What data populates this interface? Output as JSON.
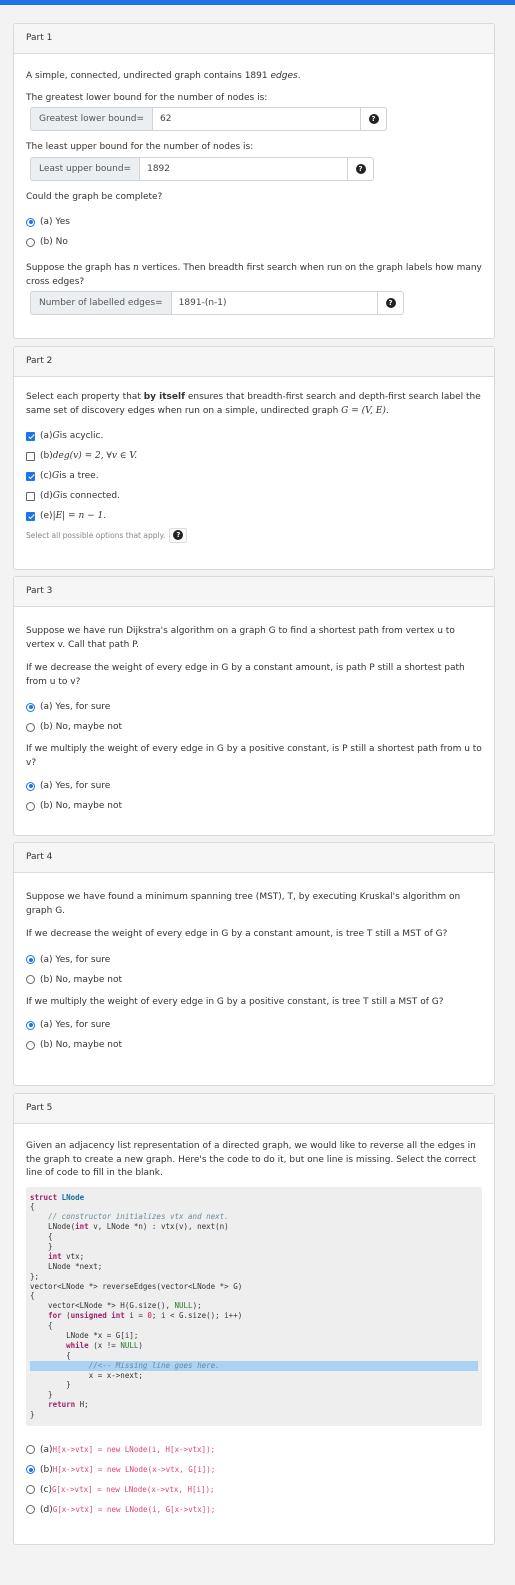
{
  "part1": {
    "title": "Part 1",
    "intro_pre": "A simple, connected, undirected graph contains 1891 ",
    "intro_em": "edges",
    "intro_post": ".",
    "q1": "The greatest lower bound for the number of nodes is:",
    "glb_label": "Greatest lower bound=",
    "glb_value": "62",
    "q2": "The least upper bound for the number of nodes is:",
    "lub_label": "Least upper bound=",
    "lub_value": "1892",
    "q3": "Could the graph be complete?",
    "opt_a": "(a) Yes",
    "opt_b": "(b) No",
    "q4_pre": "Suppose the graph has ",
    "q4_var": "n",
    "q4_post": " vertices. Then breadth first search when run on the graph labels how many cross edges?",
    "cross_label": "Number of labelled edges=",
    "cross_value": "1891-(n-1)",
    "selected": "a"
  },
  "part2": {
    "title": "Part 2",
    "prompt_pre": "Select each property that ",
    "prompt_bold": "by itself",
    "prompt_post": " ensures that breadth-first search and depth-first search label the same set of discovery edges when run on a simple, undirected graph ",
    "prompt_math": "G = (V, E).",
    "options": [
      {
        "prefix": "(e) ",
        "math": "",
        "text": ""
      },
      {
        "prefix": "",
        "math": "",
        "text": ""
      }
    ],
    "opt_a_prefix": "(a) ",
    "opt_a_math": "G",
    "opt_a_text": " is acyclic.",
    "opt_b_prefix": "(b) ",
    "opt_b_math": "deg(v) = 2, ∀v ∈ V.",
    "opt_c_prefix": "(c) ",
    "opt_c_math": "G",
    "opt_c_text": " is a tree.",
    "opt_d_prefix": "(d) ",
    "opt_d_math": "G",
    "opt_d_text": " is connected.",
    "opt_e_prefix": "(e) ",
    "opt_e_math": "|E| = n − 1.",
    "checked": {
      "a": true,
      "b": false,
      "c": true,
      "d": false,
      "e": true
    },
    "hint": "Select all possible options that apply."
  },
  "part3": {
    "title": "Part 3",
    "intro": "Suppose we have run Dijkstra's algorithm on a graph G to find a shortest path from vertex u to vertex v. Call that path P.",
    "q1": "If we decrease the weight of every edge in G by a constant amount, is path P still a shortest path from u to v?",
    "q2": "If we multiply the weight of every edge in G by a positive constant, is P still a shortest path from u to v?",
    "opt_a": "(a) Yes, for sure",
    "opt_b": "(b) No, maybe not"
  },
  "part4": {
    "title": "Part 4",
    "intro": "Suppose we have found a minimum spanning tree (MST), T, by executing Kruskal's algorithm on graph G.",
    "q1": "If we decrease the weight of every edge in G by a constant amount, is tree T still a MST of G?",
    "q2": "If we multiply the weight of every edge in G by a positive constant, is tree T still a MST of G?",
    "opt_a": "(a) Yes, for sure",
    "opt_b": "(b) No, maybe not"
  },
  "part5": {
    "title": "Part 5",
    "intro": "Given an adjacency list representation of a directed graph, we would like to reverse all the edges in the graph to create a new graph. Here's the code to do it, but one line is missing. Select the correct line of code to fill in the blank.",
    "answers": [
      {
        "prefix": "(a) ",
        "code": "H[x->vtx] = new LNode(i, H[x->vtx]);"
      },
      {
        "prefix": "(b) ",
        "code": "H[x->vtx] = new LNode(x->vtx, G[i]);"
      },
      {
        "prefix": "(c) ",
        "code": "G[x->vtx] = new LNode(x->vtx, H[i]);"
      },
      {
        "prefix": "(d) ",
        "code": "G[x->vtx] = new LNode(i, G[x->vtx]);"
      }
    ],
    "selected": "b"
  },
  "colors": {
    "accent": "#1e73e8",
    "code_answer": "#e0457b",
    "highlight": "#a9d2f5"
  },
  "icons": {
    "help": "question-circle-icon"
  }
}
